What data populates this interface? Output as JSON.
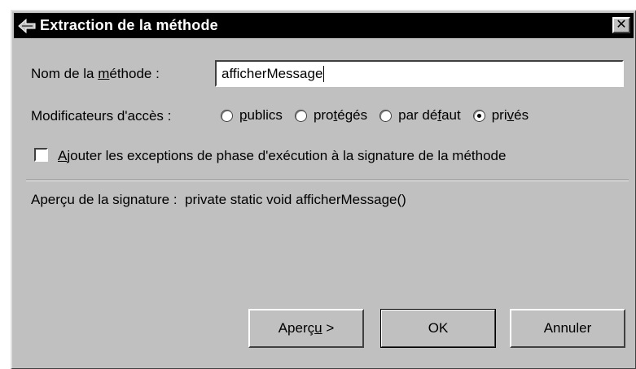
{
  "window": {
    "title": "Extraction de la méthode",
    "close_glyph": "✕"
  },
  "method_name": {
    "label_before": "Nom de la ",
    "label_accel": "m",
    "label_after": "éthode :",
    "value": "afficherMessage"
  },
  "access": {
    "label": "Modificateurs d'accès :",
    "options": [
      {
        "pre": "",
        "accel": "p",
        "post": "ublics",
        "checked": false
      },
      {
        "pre": "pro",
        "accel": "t",
        "post": "égés",
        "checked": false
      },
      {
        "pre": "par dé",
        "accel": "f",
        "post": "aut",
        "checked": false
      },
      {
        "pre": "pri",
        "accel": "v",
        "post": "és",
        "checked": true
      }
    ]
  },
  "exceptions_checkbox": {
    "accel": "A",
    "rest": "jouter les exceptions de phase d'exécution à la signature de la méthode",
    "checked": false
  },
  "preview": {
    "label": "Aperçu de la signature :",
    "value": "private static void afficherMessage()"
  },
  "buttons": {
    "preview_pre": "Aperç",
    "preview_accel": "u",
    "preview_post": " >",
    "ok": "OK",
    "cancel": "Annuler"
  },
  "icons": {
    "title": "dialog-icon",
    "close": "close-icon"
  }
}
